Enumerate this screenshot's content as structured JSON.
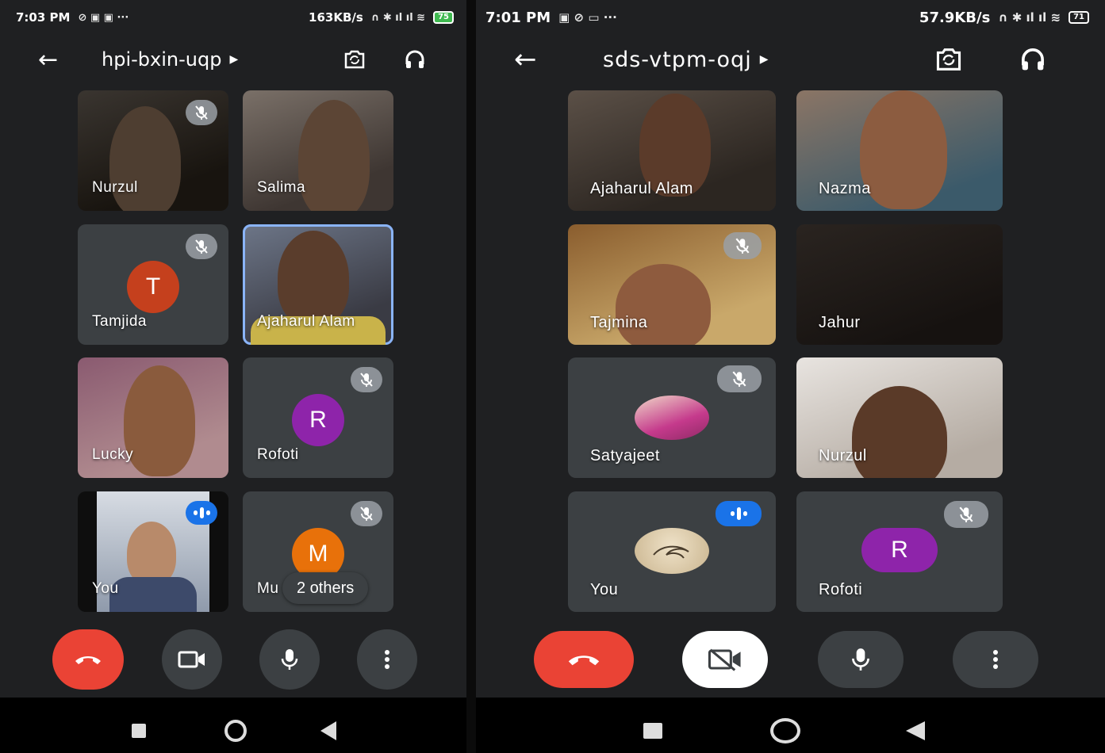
{
  "left_screen": {
    "status": {
      "time": "7:03 PM",
      "speed": "163KB/s",
      "battery": "75"
    },
    "meeting_code": "hpi-bxin-uqp",
    "tiles": [
      {
        "name": "Nurzul",
        "muted": true
      },
      {
        "name": "Salima",
        "muted": false
      },
      {
        "name": "Tamjida",
        "avatar_letter": "T",
        "avatar_color": "#c5401d",
        "muted": true
      },
      {
        "name": "Ajaharul Alam",
        "muted": false,
        "selected": true
      },
      {
        "name": "Lucky",
        "muted": false
      },
      {
        "name": "Rofoti",
        "avatar_letter": "R",
        "avatar_color": "#8e24aa",
        "muted": true
      },
      {
        "name": "You",
        "speaking": true
      },
      {
        "name": "Mu",
        "avatar_letter": "M",
        "avatar_color": "#e8710a",
        "muted": true
      }
    ],
    "others_chip": "2 others",
    "controls": [
      "end-call",
      "camera",
      "microphone",
      "more-options"
    ]
  },
  "right_screen": {
    "status": {
      "time": "7:01 PM",
      "speed": "57.9KB/s",
      "battery": "71"
    },
    "meeting_code": "sds-vtpm-oqj",
    "tiles": [
      {
        "name": "Ajaharul Alam",
        "muted": false
      },
      {
        "name": "Nazma",
        "muted": false
      },
      {
        "name": "Tajmina",
        "muted": true
      },
      {
        "name": "Jahur",
        "muted": false
      },
      {
        "name": "Satyajeet",
        "muted": true
      },
      {
        "name": "Nurzul",
        "muted": false
      },
      {
        "name": "You",
        "speaking": true
      },
      {
        "name": "Rofoti",
        "avatar_letter": "R",
        "avatar_color": "#8e24aa",
        "muted": true
      }
    ],
    "controls": [
      "end-call",
      "camera-off",
      "microphone",
      "more-options"
    ]
  },
  "colors": {
    "end_call": "#ea4335",
    "control_bg": "#3c4043",
    "speaking": "#1a73e8",
    "selected_border": "#8ab4f8",
    "mute_badge": "#9aa0a6"
  }
}
